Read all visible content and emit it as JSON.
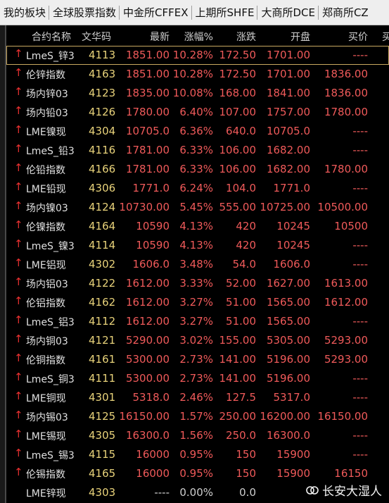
{
  "tabs": [
    "我的板块",
    "全球股票指数",
    "中金所CFFEX",
    "上期所SHFE",
    "大商所DCE",
    "郑商所CZ"
  ],
  "columns": {
    "name": "合约名称",
    "code": "文华码",
    "price": "最新",
    "pct": "涨幅%",
    "chg": "涨跌",
    "open": "开盘",
    "bid": "买价",
    "more": "买"
  },
  "rows": [
    {
      "name": "LmeS_锌3",
      "code": "4113",
      "price": "1851.00",
      "pct": "10.28%",
      "chg": "172.50",
      "open": "1701.00",
      "bid": "----",
      "arrow": "↑",
      "selected": true
    },
    {
      "name": "伦锌指数",
      "code": "4163",
      "price": "1851.00",
      "pct": "10.28%",
      "chg": "172.50",
      "open": "1701.00",
      "bid": "1836.00",
      "arrow": "↑"
    },
    {
      "name": "场内锌03",
      "code": "4123",
      "price": "1835.00",
      "pct": "10.08%",
      "chg": "168.00",
      "open": "1841.00",
      "bid": "1836.00",
      "arrow": "↑"
    },
    {
      "name": "场内铅03",
      "code": "4126",
      "price": "1780.00",
      "pct": "6.40%",
      "chg": "107.00",
      "open": "1757.00",
      "bid": "1780.00",
      "arrow": "↑"
    },
    {
      "name": "LME镍现",
      "code": "4304",
      "price": "10705.0",
      "pct": "6.36%",
      "chg": "640.0",
      "open": "10705.0",
      "bid": "----",
      "arrow": "↑"
    },
    {
      "name": "LmeS_铅3",
      "code": "4116",
      "price": "1781.00",
      "pct": "6.33%",
      "chg": "106.00",
      "open": "1682.00",
      "bid": "----",
      "arrow": "↑"
    },
    {
      "name": "伦铅指数",
      "code": "4166",
      "price": "1781.00",
      "pct": "6.33%",
      "chg": "106.00",
      "open": "1682.00",
      "bid": "1780.00",
      "arrow": "↑"
    },
    {
      "name": "LME铅现",
      "code": "4306",
      "price": "1771.0",
      "pct": "6.24%",
      "chg": "104.0",
      "open": "1771.0",
      "bid": "----",
      "arrow": "↑"
    },
    {
      "name": "场内镍03",
      "code": "4124",
      "price": "10730.00",
      "pct": "5.45%",
      "chg": "555.00",
      "open": "10725.00",
      "bid": "10500.00",
      "arrow": "↑"
    },
    {
      "name": "伦镍指数",
      "code": "4164",
      "price": "10590",
      "pct": "4.13%",
      "chg": "420",
      "open": "10245",
      "bid": "10500",
      "arrow": "↑"
    },
    {
      "name": "LmeS_镍3",
      "code": "4114",
      "price": "10590",
      "pct": "4.13%",
      "chg": "420",
      "open": "10245",
      "bid": "----",
      "arrow": "↑"
    },
    {
      "name": "LME铝现",
      "code": "4302",
      "price": "1606.0",
      "pct": "3.48%",
      "chg": "54.0",
      "open": "1606.0",
      "bid": "----",
      "arrow": "↑"
    },
    {
      "name": "场内铝03",
      "code": "4122",
      "price": "1612.00",
      "pct": "3.33%",
      "chg": "52.00",
      "open": "1627.00",
      "bid": "1613.00",
      "arrow": "↑"
    },
    {
      "name": "伦铝指数",
      "code": "4162",
      "price": "1612.00",
      "pct": "3.27%",
      "chg": "51.00",
      "open": "1565.00",
      "bid": "1612.00",
      "arrow": "↑"
    },
    {
      "name": "LmeS_铝3",
      "code": "4112",
      "price": "1612.00",
      "pct": "3.27%",
      "chg": "51.00",
      "open": "1565.00",
      "bid": "----",
      "arrow": "↑"
    },
    {
      "name": "场内铜03",
      "code": "4121",
      "price": "5290.00",
      "pct": "3.02%",
      "chg": "155.00",
      "open": "5305.00",
      "bid": "5293.00",
      "arrow": "↑"
    },
    {
      "name": "伦铜指数",
      "code": "4161",
      "price": "5300.00",
      "pct": "2.73%",
      "chg": "141.00",
      "open": "5196.00",
      "bid": "5293.00",
      "arrow": "↑"
    },
    {
      "name": "LmeS_铜3",
      "code": "4111",
      "price": "5300.00",
      "pct": "2.73%",
      "chg": "141.00",
      "open": "5196.00",
      "bid": "----",
      "arrow": "↑"
    },
    {
      "name": "LME铜现",
      "code": "4301",
      "price": "5318.0",
      "pct": "2.46%",
      "chg": "127.5",
      "open": "5317.0",
      "bid": "----",
      "arrow": "↑"
    },
    {
      "name": "场内锡03",
      "code": "4125",
      "price": "16150.00",
      "pct": "1.57%",
      "chg": "250.00",
      "open": "16200.00",
      "bid": "16150.00",
      "arrow": "↑"
    },
    {
      "name": "LME锡现",
      "code": "4305",
      "price": "16300.0",
      "pct": "1.56%",
      "chg": "250.0",
      "open": "16300.0",
      "bid": "----",
      "arrow": "↑"
    },
    {
      "name": "LmeS_锡3",
      "code": "4115",
      "price": "16000",
      "pct": "0.95%",
      "chg": "150",
      "open": "15900",
      "bid": "----",
      "arrow": "↑"
    },
    {
      "name": "伦锡指数",
      "code": "4165",
      "price": "16000",
      "pct": "0.95%",
      "chg": "150",
      "open": "15900",
      "bid": "16150",
      "arrow": "↑"
    },
    {
      "name": "LME锌现",
      "code": "4303",
      "price": "----",
      "pct": "0.00%",
      "chg": "0.0",
      "open": "",
      "bid": "",
      "arrow": "",
      "flat": true
    }
  ],
  "watermark": "长安大湿人",
  "colors": {
    "up": "#f05a5a",
    "code": "#e8d27a",
    "name": "#e0e0e0",
    "background": "#000000"
  }
}
